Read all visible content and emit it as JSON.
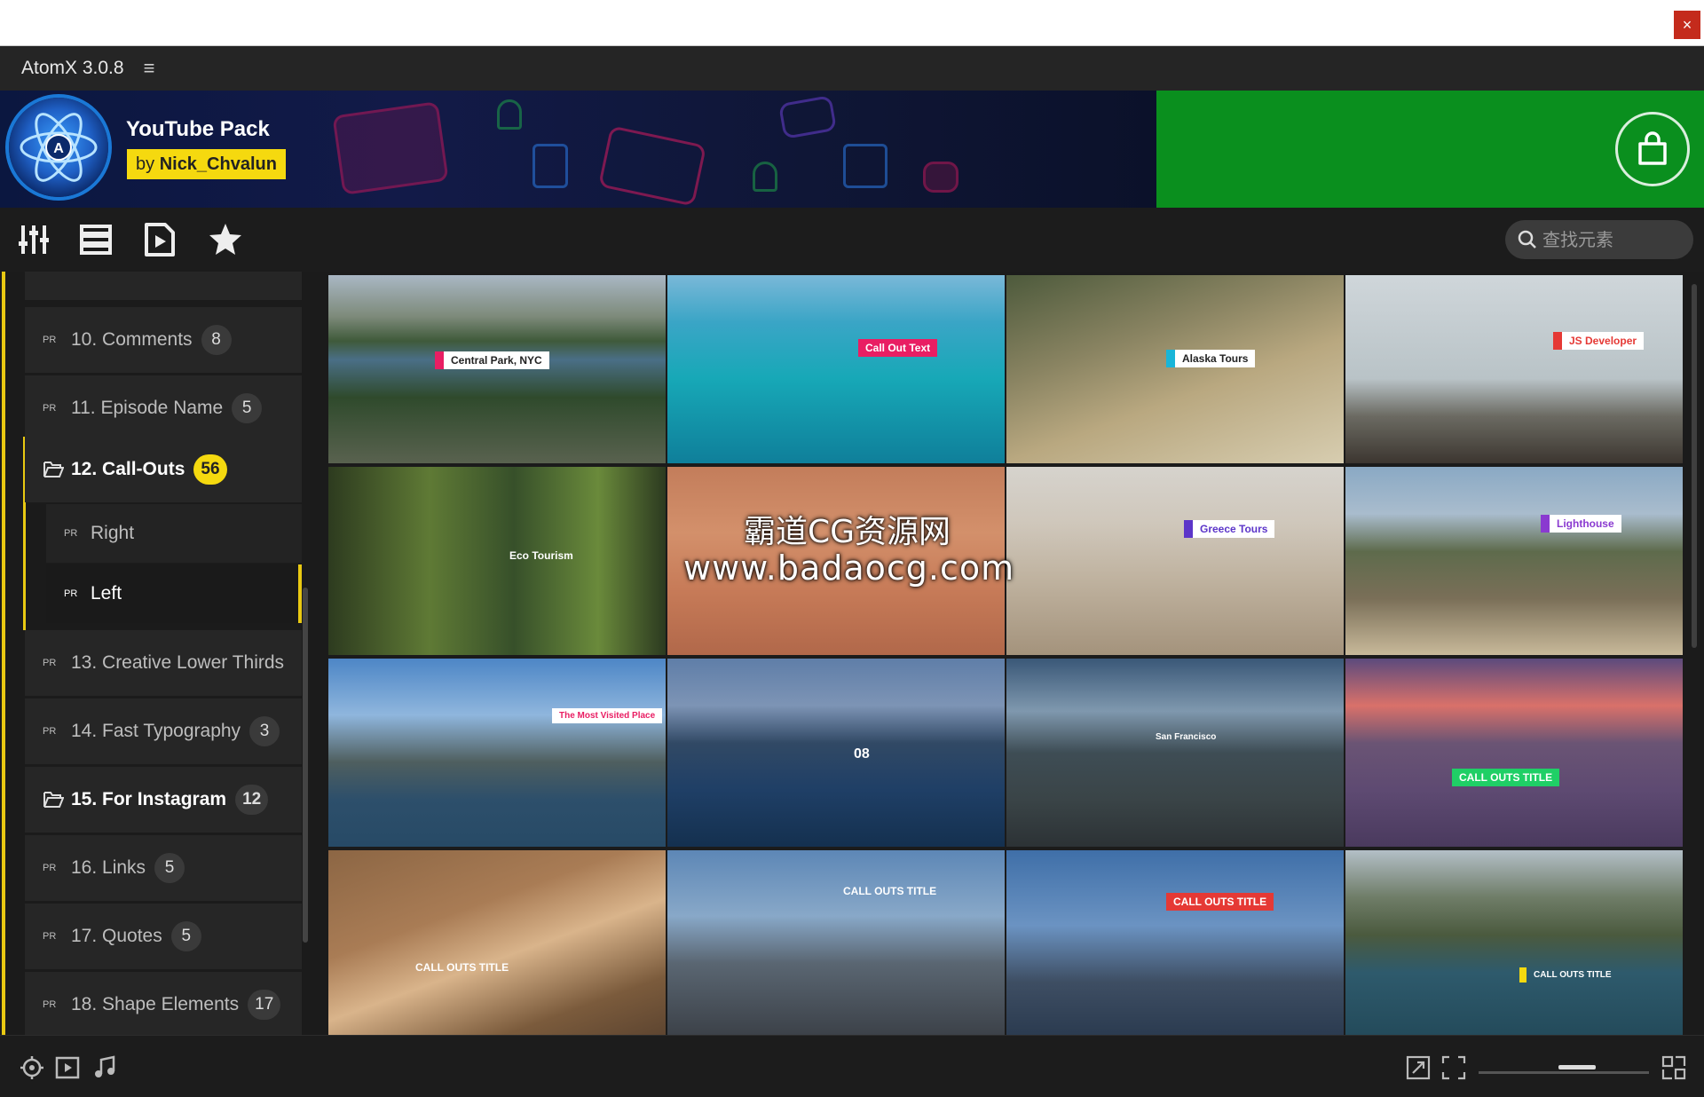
{
  "window": {
    "close_label": "×"
  },
  "app": {
    "title": "AtomX 3.0.8",
    "menu_icon": "hamburger-icon"
  },
  "banner": {
    "pack_title": "YouTube Pack",
    "author_prefix": "by",
    "author_name": "Nick_Chvalun",
    "cart_icon": "shopping-bag-icon",
    "colors": {
      "left_bg": "#0f1740",
      "right_bg": "#0a8f1e",
      "author_bg": "#f5d90f"
    }
  },
  "toolbar": {
    "icons": [
      "sliders-icon",
      "list-icon",
      "video-file-icon",
      "star-icon"
    ],
    "search_placeholder": "查找元素"
  },
  "sidebar": {
    "items": [
      {
        "label": "10. Comments",
        "count": "8"
      },
      {
        "label": "11. Episode Name",
        "count": "5"
      },
      {
        "label": "12. Call-Outs",
        "count": "56",
        "expanded": true,
        "children": [
          {
            "label": "Right"
          },
          {
            "label": "Left",
            "active": true
          }
        ]
      },
      {
        "label": "13. Creative Lower Thirds",
        "count": ""
      },
      {
        "label": "14. Fast Typography",
        "count": "3"
      },
      {
        "label": "15. For Instagram",
        "count": "12"
      },
      {
        "label": "16. Links",
        "count": "5"
      },
      {
        "label": "17. Quotes",
        "count": "5"
      },
      {
        "label": "18. Shape Elements",
        "count": "17"
      }
    ],
    "accent_color": "#e9c912",
    "item_icon_text": "PR"
  },
  "grid": {
    "thumbnails": [
      {
        "caption": "Central Park, NYC",
        "scene": "city park lake aerial"
      },
      {
        "caption": "Call Out Text",
        "scene": "turquoise sea"
      },
      {
        "caption": "Alaska Tours",
        "scene": "hiker on hill"
      },
      {
        "caption": "JS Developer",
        "scene": "developer at desk"
      },
      {
        "caption": "Eco Tourism",
        "scene": "forest path"
      },
      {
        "caption": "",
        "scene": "red desert dune"
      },
      {
        "caption": "Greece Tours",
        "scene": "ancient columns"
      },
      {
        "caption": "Lighthouse",
        "scene": "coastal lighthouse"
      },
      {
        "caption": "The Most Visited Place",
        "scene": "harbour bridge"
      },
      {
        "caption": "08",
        "scene": "long bridge"
      },
      {
        "caption": "San Francisco",
        "scene": "mountain city"
      },
      {
        "caption": "CALL OUTS TITLE",
        "scene": "bridge sunset"
      },
      {
        "caption": "CALL OUTS TITLE",
        "scene": "desert castle"
      },
      {
        "caption": "CALL OUTS TITLE",
        "scene": "city skyline"
      },
      {
        "caption": "CALL OUTS TITLE",
        "scene": "skyscrapers"
      },
      {
        "caption": "CALL OUTS TITLE",
        "scene": "rocky coast"
      }
    ]
  },
  "watermark": {
    "line1": "霸道CG资源网",
    "line2": "www.badaocg.com"
  },
  "bottombar": {
    "left_icons": [
      "target-icon",
      "play-icon",
      "music-icon"
    ],
    "right_icons": [
      "expand-icon",
      "fullscreen-icon",
      "grid-size-icon"
    ]
  }
}
